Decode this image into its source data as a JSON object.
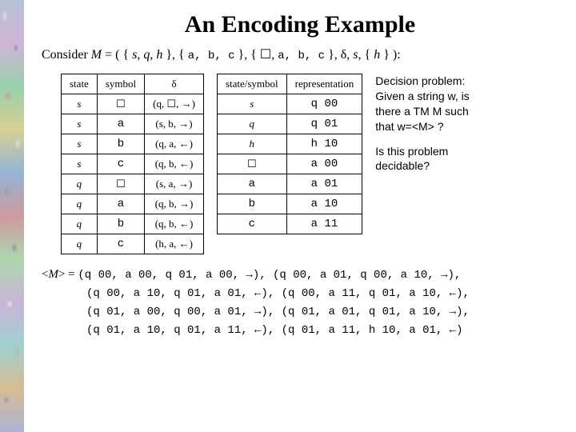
{
  "title": "An Encoding Example",
  "consider_line": "Consider M = ( { s, q, h }, { a, b, c }, { ☐, a, b, c }, δ, s, { h } ):",
  "delta_table": {
    "headers": [
      "state",
      "symbol",
      "δ"
    ],
    "rows": [
      [
        "s",
        "☐",
        "(q, ☐, →)"
      ],
      [
        "s",
        "a",
        "(s, b, →)"
      ],
      [
        "s",
        "b",
        "(q, a, ←)"
      ],
      [
        "s",
        "c",
        "(q, b, ←)"
      ],
      [
        "q",
        "☐",
        "(s, a, →)"
      ],
      [
        "q",
        "a",
        "(q, b, →)"
      ],
      [
        "q",
        "b",
        "(q, b, ←)"
      ],
      [
        "q",
        "c",
        "(h, a, ←)"
      ]
    ]
  },
  "rep_table": {
    "headers": [
      "state/symbol",
      "representation"
    ],
    "rows": [
      [
        "s",
        "q 00"
      ],
      [
        "q",
        "q 01"
      ],
      [
        "h",
        "h 10"
      ],
      [
        "☐",
        "a 00"
      ],
      [
        "a",
        "a 01"
      ],
      [
        "b",
        "a 10"
      ],
      [
        "c",
        "a 11"
      ]
    ]
  },
  "decision_text": "Decision problem: Given a string w, is there a TM M such that w=<M> ?",
  "decidable_text": "Is this problem decidable?",
  "m_label": "<M> =",
  "m_lines": [
    "(q 00, a 00, q 01, a 00, →),  (q 00, a 01, q 00, a 10, →),",
    "(q 00, a 10, q 01, a 01, ←), (q 00, a 11, q 01, a 10, ←),",
    "(q 01, a 00, q 00, a 01, →), (q 01, a 01, q 01, a 10, →),",
    "(q 01, a 10, q 01, a 11, ←), (q 01, a 11, h 10, a 01, ←)"
  ]
}
